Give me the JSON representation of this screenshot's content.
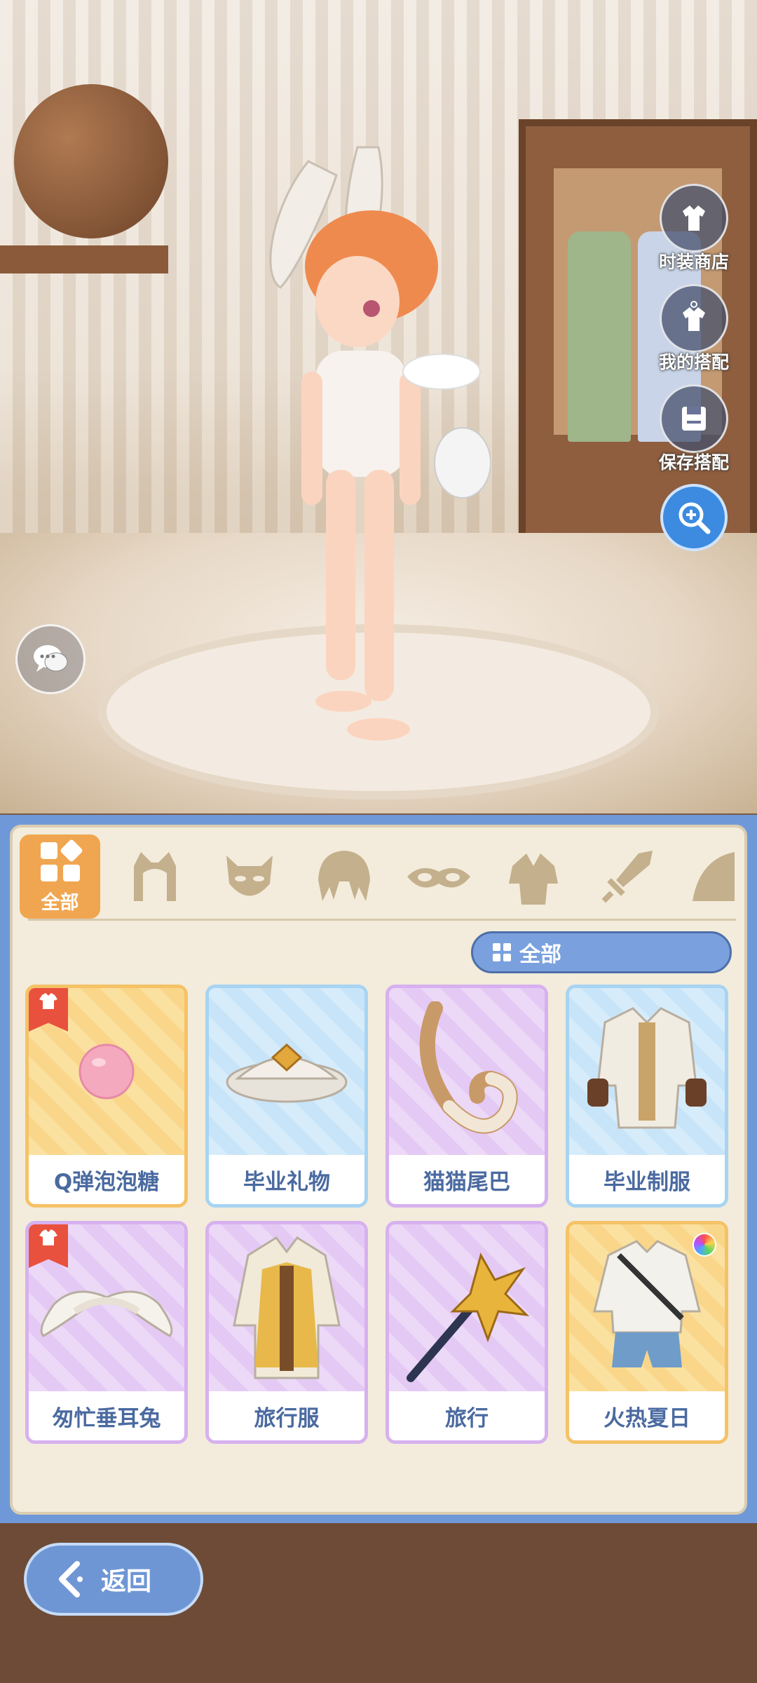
{
  "side_menu": {
    "shop_label": "时装商店",
    "my_outfit_label": "我的搭配",
    "save_outfit_label": "保存搭配"
  },
  "tabs": {
    "active_label": "全部",
    "icons": [
      "grid-icon",
      "cat-ears-icon",
      "mask-icon",
      "hair-icon",
      "eye-mask-icon",
      "outfit-icon",
      "sword-icon",
      "wing-icon"
    ]
  },
  "filter": {
    "label": "全部"
  },
  "items": [
    {
      "name": "Q弹泡泡糖",
      "rarity_color": "orange",
      "tag": true
    },
    {
      "name": "毕业礼物",
      "rarity_color": "blue",
      "tag": false
    },
    {
      "name": "猫猫尾巴",
      "rarity_color": "purple",
      "tag": false
    },
    {
      "name": "毕业制服",
      "rarity_color": "blue",
      "tag": false
    },
    {
      "name": "匆忙垂耳兔",
      "rarity_color": "purple",
      "tag": true
    },
    {
      "name": "旅行服",
      "rarity_color": "purple",
      "tag": false
    },
    {
      "name": "旅行",
      "rarity_color": "purple",
      "tag": false
    },
    {
      "name": "火热夏日",
      "rarity_color": "orange",
      "tag": false,
      "color_variant": true
    }
  ],
  "back_button": {
    "label": "返回"
  }
}
